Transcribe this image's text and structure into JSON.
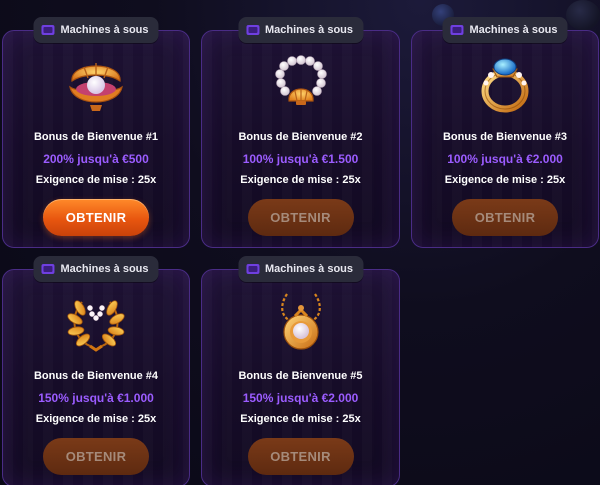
{
  "category_label": "Machines à sous",
  "colors": {
    "accent_purple": "#9b5cff",
    "button_orange": "#ff7a1a",
    "button_disabled": "#6a3214",
    "card_border": "#4a2c86",
    "card_bg": "#1a0f2e"
  },
  "cards": [
    {
      "icon": "pearl-shell-icon",
      "title": "Bonus de Bienvenue #1",
      "offer": "200% jusqu'à €500",
      "wager": "Exigence de mise : 25x",
      "button": "OBTENIR",
      "button_state": "active"
    },
    {
      "icon": "pearl-necklace-shell-icon",
      "title": "Bonus de Bienvenue #2",
      "offer": "100% jusqu'à €1.500",
      "wager": "Exigence de mise : 25x",
      "button": "OBTENIR",
      "button_state": "disabled"
    },
    {
      "icon": "gold-ring-icon",
      "title": "Bonus de Bienvenue #3",
      "offer": "100% jusqu'à €2.000",
      "wager": "Exigence de mise : 25x",
      "button": "OBTENIR",
      "button_state": "disabled"
    },
    {
      "icon": "laurel-wreath-icon",
      "title": "Bonus de Bienvenue #4",
      "offer": "150% jusqu'à €1.000",
      "wager": "Exigence de mise : 25x",
      "button": "OBTENIR",
      "button_state": "disabled"
    },
    {
      "icon": "pearl-pendant-icon",
      "title": "Bonus de Bienvenue #5",
      "offer": "150% jusqu'à €2.000",
      "wager": "Exigence de mise : 25x",
      "button": "OBTENIR",
      "button_state": "disabled"
    }
  ]
}
